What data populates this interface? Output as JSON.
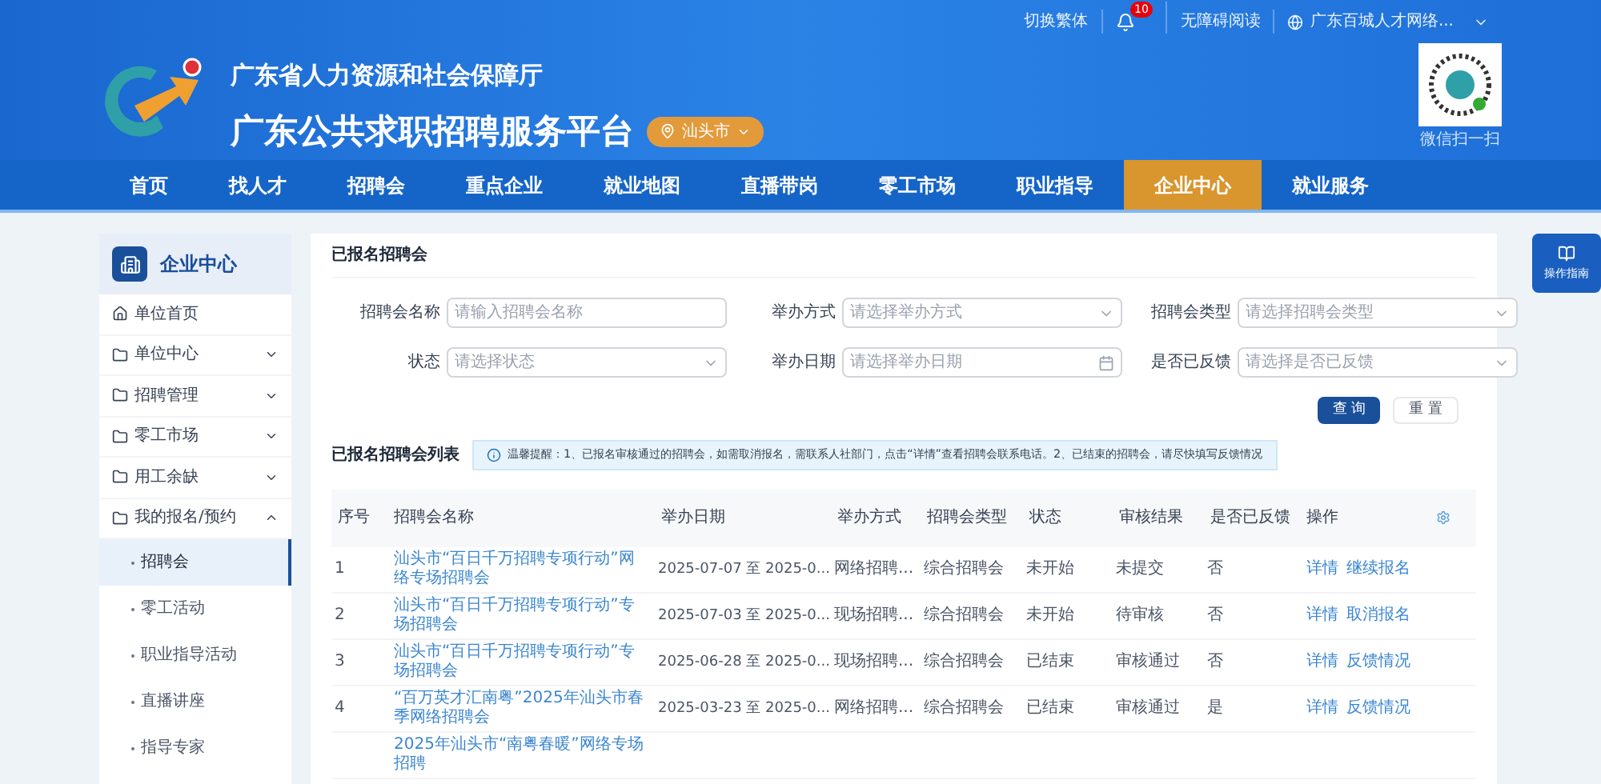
{
  "top_bar": {
    "links": [
      {
        "kind": "text",
        "label": "切换繁体"
      },
      {
        "kind": "bell",
        "badge": "10"
      },
      {
        "kind": "text",
        "label": "无障碍阅读"
      },
      {
        "kind": "site",
        "label": "广东百城人才网络..."
      }
    ]
  },
  "header": {
    "org": "广东省人力资源和社会保障厅",
    "title": "广东公共求职招聘服务平台",
    "location": "汕头市",
    "qr_caption": "微信扫一扫"
  },
  "nav": [
    {
      "label": "首页",
      "selected": false
    },
    {
      "label": "找人才",
      "selected": false
    },
    {
      "label": "招聘会",
      "selected": false
    },
    {
      "label": "重点企业",
      "selected": false
    },
    {
      "label": "就业地图",
      "selected": false
    },
    {
      "label": "直播带岗",
      "selected": false
    },
    {
      "label": "零工市场",
      "selected": false
    },
    {
      "label": "职业指导",
      "selected": false
    },
    {
      "label": "企业中心",
      "selected": true
    },
    {
      "label": "就业服务",
      "selected": false
    }
  ],
  "sidebar": {
    "title": "企业中心",
    "items": [
      {
        "kind": "home",
        "label": "单位首页"
      },
      {
        "kind": "folder",
        "label": "单位中心",
        "expanded": false
      },
      {
        "kind": "folder",
        "label": "招聘管理",
        "expanded": false
      },
      {
        "kind": "folder",
        "label": "零工市场",
        "expanded": false
      },
      {
        "kind": "folder",
        "label": "用工余缺",
        "expanded": false
      },
      {
        "kind": "folder",
        "label": "我的报名/预约",
        "expanded": true,
        "children": [
          {
            "label": "招聘会",
            "selected": true
          },
          {
            "label": "零工活动",
            "selected": false
          },
          {
            "label": "职业指导活动",
            "selected": false
          },
          {
            "label": "直播讲座",
            "selected": false
          },
          {
            "label": "指导专家",
            "selected": false
          }
        ]
      }
    ]
  },
  "guide_button": "操作指南",
  "panel_title": "已报名招聘会",
  "filters": [
    {
      "kind": "input",
      "label": "招聘会名称",
      "placeholder": "请输入招聘会名称"
    },
    {
      "kind": "select",
      "label": "举办方式",
      "placeholder": "请选择举办方式"
    },
    {
      "kind": "select",
      "label": "招聘会类型",
      "placeholder": "请选择招聘会类型"
    },
    {
      "kind": "select",
      "label": "状态",
      "placeholder": "请选择状态"
    },
    {
      "kind": "date",
      "label": "举办日期",
      "placeholder": "请选择举办日期"
    },
    {
      "kind": "select",
      "label": "是否已反馈",
      "placeholder": "请选择是否已反馈"
    }
  ],
  "buttons": [
    {
      "kind": "primary",
      "label": "查 询"
    },
    {
      "kind": "default",
      "label": "重 置"
    }
  ],
  "list_title": "已报名招聘会列表",
  "notice": "温馨提醒：1、已报名审核通过的招聘会，如需取消报名，需联系人社部门，点击“详情”查看招聘会联系电话。2、已结束的招聘会，请尽快填写反馈情况",
  "table": {
    "columns": [
      "序号",
      "招聘会名称",
      "举办日期",
      "举办方式",
      "招聘会类型",
      "状态",
      "审核结果",
      "是否已反馈",
      "操作"
    ],
    "rows": [
      {
        "cells": [
          "1",
          "汕头市“百日千万招聘专项行动”网络专场招聘会",
          "2025-07-07 至 2025-0...",
          "网络招聘...",
          "综合招聘会",
          "未开始",
          "未提交",
          "否"
        ],
        "actions": [
          "详情",
          "继续报名"
        ]
      },
      {
        "cells": [
          "2",
          "汕头市“百日千万招聘专项行动”专场招聘会",
          "2025-07-03 至 2025-0...",
          "现场招聘...",
          "综合招聘会",
          "未开始",
          "待审核",
          "否"
        ],
        "actions": [
          "详情",
          "取消报名"
        ]
      },
      {
        "cells": [
          "3",
          "汕头市“百日千万招聘专项行动”专场招聘会",
          "2025-06-28 至 2025-0...",
          "现场招聘...",
          "综合招聘会",
          "已结束",
          "审核通过",
          "否"
        ],
        "actions": [
          "详情",
          "反馈情况"
        ]
      },
      {
        "cells": [
          "4",
          "“百万英才汇南粤”2025年汕头市春季网络招聘会",
          "2025-03-23 至 2025-0...",
          "网络招聘...",
          "综合招聘会",
          "已结束",
          "审核通过",
          "是"
        ],
        "actions": [
          "详情",
          "反馈情况"
        ]
      },
      {
        "cells": [
          "",
          "2025年汕头市“南粤春暖”网络专场招聘"
        ],
        "actions": []
      }
    ]
  }
}
